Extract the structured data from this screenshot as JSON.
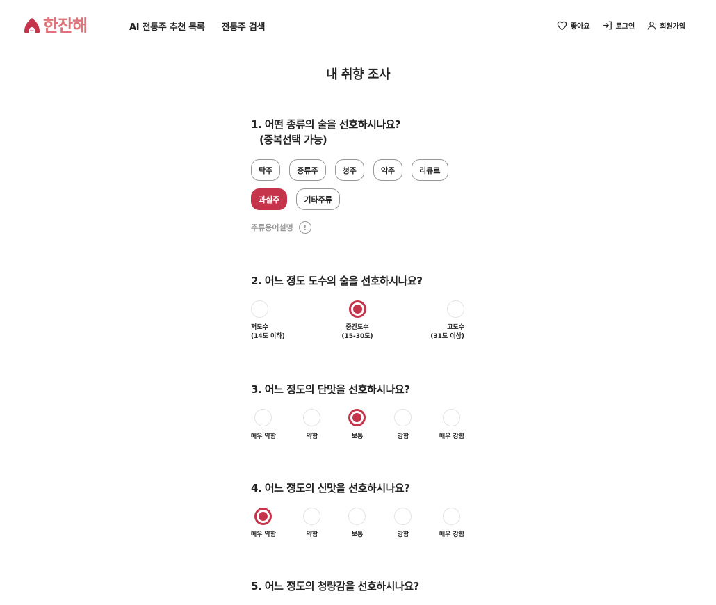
{
  "header": {
    "logo_text": "한잔해",
    "nav": [
      "AI 전통주 추천 목록",
      "전통주 검색"
    ],
    "util": {
      "like": "좋아요",
      "login": "로그인",
      "signup": "회원가입"
    }
  },
  "page_title": "내 취향 조사",
  "q1": {
    "title": "1. 어떤 종류의 술을 선호하시나요?",
    "subtitle": "(중복선택 가능)",
    "options": [
      "탁주",
      "증류주",
      "청주",
      "약주",
      "리큐르",
      "과실주",
      "기타주류"
    ],
    "selected": "과실주",
    "glossary_label": "주류용어설명",
    "glossary_icon": "!"
  },
  "q2": {
    "title": "2. 어느 정도 도수의 술을 선호하시나요?",
    "options": [
      {
        "label": "저도수",
        "sub": "(14도 이하)"
      },
      {
        "label": "중간도수",
        "sub": "(15-30도)"
      },
      {
        "label": "고도수",
        "sub": "(31도 이상)"
      }
    ],
    "selected_index": 1
  },
  "q3": {
    "title": "3. 어느 정도의 단맛을 선호하시나요?",
    "options": [
      "매우 약함",
      "약함",
      "보통",
      "강함",
      "매우 강함"
    ],
    "selected_index": 2
  },
  "q4": {
    "title": "4. 어느 정도의 신맛을 선호하시나요?",
    "options": [
      "매우 약함",
      "약함",
      "보통",
      "강함",
      "매우 강함"
    ],
    "selected_index": 0
  },
  "q5": {
    "title": "5. 어느 정도의 청량감을 선호하시나요?"
  },
  "colors": {
    "accent": "#c5344a",
    "logo": "#e0727a",
    "border": "#999999",
    "radio_border": "#e3e3e3"
  }
}
